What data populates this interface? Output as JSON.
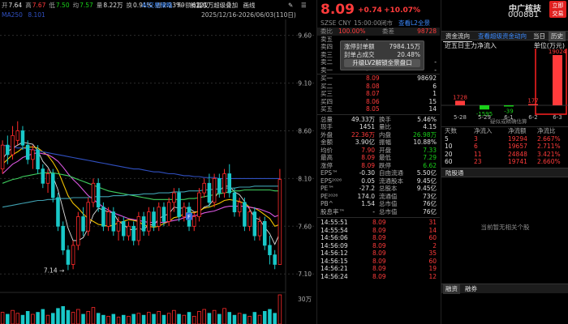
{
  "info_bar": {
    "items": [
      {
        "label": "开",
        "value": "7.64",
        "color": "#e0e0e0"
      },
      {
        "label": "高",
        "value": "7.67",
        "color": "#ff3b3b"
      },
      {
        "label": "低",
        "value": "7.50",
        "color": "#19d119"
      },
      {
        "label": "均",
        "value": "7.57",
        "color": "#19d119"
      },
      {
        "label": "量",
        "value": "8.22万",
        "color": "#e0e0e0"
      },
      {
        "label": "换",
        "value": "0.91%",
        "color": "#e0e0e0"
      },
      {
        "label": "振",
        "value": "2.23%",
        "color": "#e0e0e0"
      },
      {
        "label": "额",
        "value": "6221万",
        "color": "#e0e0e0"
      }
    ],
    "ma_label": "MA250",
    "ma_value": "8.101",
    "date_range": "2025/12/16-2026/06/03(110日)",
    "ai_label": "AI交易策略",
    "f9_label": "F9",
    "fq_label": "前复权",
    "overlay_label": "超级叠加",
    "tools_label": "画线"
  },
  "chart_data": {
    "type": "candlestick",
    "ylim": [
      7.0,
      9.75
    ],
    "yticks": [
      "9.60",
      "9.10",
      "8.60",
      "8.10",
      "7.60",
      "7.10"
    ],
    "ytick_values": [
      9.6,
      9.1,
      8.6,
      8.1,
      7.6,
      7.1
    ],
    "annotations": [
      {
        "text": "7.14",
        "value": 7.14,
        "index": 13
      },
      {
        "text": "F",
        "value": 7.7,
        "index": 37
      }
    ],
    "candles": [
      [
        8.2,
        8.45,
        8.15,
        8.5
      ],
      [
        8.45,
        8.35,
        8.25,
        8.55
      ],
      [
        8.35,
        8.55,
        8.3,
        8.65
      ],
      [
        8.5,
        8.6,
        8.45,
        8.7
      ],
      [
        8.6,
        8.45,
        8.4,
        8.65
      ],
      [
        8.45,
        8.3,
        8.25,
        8.5
      ],
      [
        8.3,
        8.4,
        8.2,
        8.45
      ],
      [
        8.4,
        8.2,
        8.15,
        8.45
      ],
      [
        8.2,
        8.05,
        8.0,
        8.25
      ],
      [
        8.05,
        8.15,
        7.95,
        8.2
      ],
      [
        8.15,
        7.9,
        7.85,
        8.2
      ],
      [
        7.9,
        7.6,
        7.55,
        7.95
      ],
      [
        7.6,
        7.35,
        7.3,
        7.65
      ],
      [
        7.35,
        7.2,
        7.14,
        7.4
      ],
      [
        7.2,
        7.4,
        7.15,
        7.45
      ],
      [
        7.4,
        7.7,
        7.35,
        7.75
      ],
      [
        7.7,
        7.55,
        7.5,
        7.8
      ],
      [
        7.55,
        7.85,
        7.5,
        7.9
      ],
      [
        7.85,
        8.05,
        7.8,
        8.1
      ],
      [
        8.05,
        7.8,
        7.75,
        8.1
      ],
      [
        7.8,
        7.6,
        7.55,
        7.85
      ],
      [
        7.6,
        7.75,
        7.55,
        7.8
      ],
      [
        7.75,
        7.55,
        7.5,
        7.8
      ],
      [
        7.55,
        7.65,
        7.45,
        7.7
      ],
      [
        7.65,
        7.5,
        7.45,
        7.7
      ],
      [
        7.5,
        7.6,
        7.45,
        7.65
      ],
      [
        7.6,
        7.45,
        7.4,
        7.65
      ],
      [
        7.45,
        7.7,
        7.4,
        7.75
      ],
      [
        7.7,
        7.55,
        7.5,
        7.75
      ],
      [
        7.55,
        7.75,
        7.5,
        7.8
      ],
      [
        7.75,
        7.6,
        7.55,
        7.8
      ],
      [
        7.6,
        7.8,
        7.55,
        7.85
      ],
      [
        7.8,
        7.65,
        7.6,
        7.85
      ],
      [
        7.65,
        7.85,
        7.6,
        7.9
      ],
      [
        7.85,
        7.95,
        7.75,
        8.0
      ],
      [
        7.95,
        7.7,
        7.65,
        8.0
      ],
      [
        7.7,
        7.8,
        7.65,
        7.85
      ],
      [
        7.8,
        7.6,
        7.55,
        7.85
      ],
      [
        7.6,
        7.7,
        7.55,
        7.75
      ],
      [
        7.7,
        7.95,
        7.65,
        8.0
      ],
      [
        7.95,
        8.05,
        7.9,
        8.1
      ],
      [
        8.05,
        7.85,
        7.8,
        8.15
      ],
      [
        7.85,
        8.1,
        7.8,
        8.15
      ],
      [
        8.1,
        7.95,
        7.9,
        8.15
      ],
      [
        7.95,
        8.15,
        7.9,
        8.2
      ],
      [
        8.15,
        7.95,
        7.9,
        8.25
      ],
      [
        7.95,
        7.75,
        7.7,
        8.0
      ],
      [
        7.75,
        7.85,
        7.7,
        7.9
      ],
      [
        7.85,
        7.6,
        7.55,
        7.9
      ],
      [
        7.6,
        7.75,
        7.55,
        7.8
      ],
      [
        7.75,
        7.5,
        7.45,
        7.8
      ],
      [
        7.5,
        7.65,
        7.45,
        7.7
      ],
      [
        7.65,
        7.4,
        7.35,
        7.7
      ],
      [
        7.4,
        7.3,
        7.2,
        7.5
      ],
      [
        7.3,
        7.2,
        7.15,
        7.35
      ],
      [
        7.2,
        8.09,
        7.2,
        8.2
      ]
    ],
    "ma_lines": [
      {
        "name": "MA5",
        "color": "#e0e0e0",
        "values": [
          8.3,
          8.38,
          8.42,
          8.45,
          8.48,
          8.47,
          8.46,
          8.39,
          8.28,
          8.22,
          8.12,
          7.98,
          7.78,
          7.58,
          7.45,
          7.45,
          7.48,
          7.58,
          7.72,
          7.79,
          7.77,
          7.75,
          7.74,
          7.65,
          7.62,
          7.57,
          7.56,
          7.58,
          7.56,
          7.62,
          7.61,
          7.68,
          7.71,
          7.73,
          7.8,
          7.79,
          7.79,
          7.79,
          7.75,
          7.75,
          7.8,
          7.82,
          7.89,
          7.97,
          8.02,
          8.02,
          7.96,
          7.93,
          7.86,
          7.78,
          7.69,
          7.67,
          7.59,
          7.52,
          7.41,
          7.53
        ]
      },
      {
        "name": "MA10",
        "color": "#f2c200",
        "values": [
          8.25,
          8.3,
          8.35,
          8.38,
          8.42,
          8.43,
          8.43,
          8.42,
          8.38,
          8.34,
          8.27,
          8.18,
          8.05,
          7.92,
          7.84,
          7.79,
          7.73,
          7.68,
          7.65,
          7.62,
          7.61,
          7.6,
          7.61,
          7.64,
          7.65,
          7.67,
          7.66,
          7.65,
          7.61,
          7.6,
          7.59,
          7.6,
          7.63,
          7.65,
          7.69,
          7.7,
          7.73,
          7.75,
          7.74,
          7.76,
          7.79,
          7.8,
          7.82,
          7.84,
          7.87,
          7.88,
          7.87,
          7.86,
          7.84,
          7.8,
          7.79,
          7.76,
          7.72,
          7.68,
          7.6,
          7.62
        ]
      },
      {
        "name": "MA20",
        "color": "#d957e0",
        "values": [
          8.15,
          8.2,
          8.25,
          8.28,
          8.32,
          8.34,
          8.36,
          8.37,
          8.36,
          8.35,
          8.32,
          8.28,
          8.22,
          8.15,
          8.09,
          8.04,
          7.98,
          7.92,
          7.88,
          7.84,
          7.8,
          7.77,
          7.74,
          7.72,
          7.7,
          7.68,
          7.67,
          7.66,
          7.65,
          7.64,
          7.64,
          7.64,
          7.64,
          7.65,
          7.66,
          7.67,
          7.69,
          7.7,
          7.71,
          7.72,
          7.74,
          7.75,
          7.76,
          7.78,
          7.8,
          7.81,
          7.81,
          7.81,
          7.81,
          7.8,
          7.79,
          7.78,
          7.76,
          7.74,
          7.7,
          7.72
        ]
      },
      {
        "name": "MA60",
        "color": "#3fcf5f",
        "values": [
          8.05,
          8.07,
          8.09,
          8.1,
          8.12,
          8.13,
          8.14,
          8.15,
          8.16,
          8.16,
          8.16,
          8.15,
          8.14,
          8.13,
          8.11,
          8.09,
          8.07,
          8.05,
          8.03,
          8.01,
          7.99,
          7.97,
          7.96,
          7.95,
          7.94,
          7.93,
          7.92,
          7.91,
          7.9,
          7.89,
          7.88,
          7.88,
          7.88,
          7.88,
          7.88,
          7.88,
          7.88,
          7.89,
          7.89,
          7.9,
          7.91,
          7.92,
          7.93,
          7.94,
          7.95,
          7.96,
          7.97,
          7.97,
          7.98,
          7.98,
          7.98,
          7.98,
          7.98,
          7.98,
          7.97,
          7.97
        ]
      },
      {
        "name": "MA120",
        "color": "#3fa0b0",
        "values": [
          7.8,
          7.81,
          7.82,
          7.83,
          7.84,
          7.85,
          7.86,
          7.87,
          7.87,
          7.88,
          7.88,
          7.89,
          7.89,
          7.89,
          7.9,
          7.9,
          7.9,
          7.9,
          7.91,
          7.91,
          7.91,
          7.91,
          7.92,
          7.92,
          7.92,
          7.93,
          7.93,
          7.93,
          7.94,
          7.94,
          7.94,
          7.95,
          7.95,
          7.95,
          7.96,
          7.96,
          7.96,
          7.97,
          7.97,
          7.97,
          7.98,
          7.98,
          7.99,
          7.99,
          8.0,
          8.0,
          8.0,
          8.01,
          8.01,
          8.01,
          8.02,
          8.02,
          8.02,
          8.02,
          8.02,
          8.02
        ]
      },
      {
        "name": "MA250",
        "color": "#3050c0",
        "values": [
          8.45,
          8.44,
          8.43,
          8.42,
          8.42,
          8.41,
          8.4,
          8.39,
          8.38,
          8.37,
          8.36,
          8.35,
          8.34,
          8.33,
          8.32,
          8.31,
          8.3,
          8.29,
          8.28,
          8.27,
          8.26,
          8.25,
          8.24,
          8.23,
          8.22,
          8.21,
          8.2,
          8.2,
          8.19,
          8.18,
          8.17,
          8.17,
          8.16,
          8.15,
          8.15,
          8.14,
          8.13,
          8.13,
          8.12,
          8.12,
          8.11,
          8.11,
          8.11,
          8.1,
          8.1,
          8.1,
          8.1,
          8.1,
          8.1,
          8.1,
          8.1,
          8.1,
          8.1,
          8.1,
          8.1,
          8.1
        ]
      }
    ],
    "volume_label": "30万",
    "volumes": [
      12,
      10,
      14,
      11,
      9,
      13,
      10,
      12,
      15,
      9,
      11,
      16,
      18,
      14,
      12,
      15,
      10,
      13,
      17,
      11,
      9,
      8,
      10,
      7,
      9,
      8,
      10,
      11,
      9,
      12,
      10,
      13,
      9,
      11,
      14,
      10,
      9,
      12,
      8,
      13,
      15,
      11,
      14,
      10,
      16,
      12,
      9,
      11,
      10,
      8,
      12,
      9,
      13,
      15,
      11,
      30
    ]
  },
  "quote": {
    "price": "8.09",
    "change": "+0.74",
    "change_pct": "+10.07%",
    "name": "中广核技",
    "code": "000881",
    "badge_top": "立即",
    "badge_bottom": "交易",
    "meta_codes": [
      "SZSE",
      "CNY",
      "15:00:00",
      "闭市"
    ],
    "l2_link": "查看L2全景",
    "webi_label": "委比",
    "webi_value": "100.00%",
    "weicha_label": "委差",
    "weicha_value": "98728",
    "sell_rows": [
      {
        "label": "卖五",
        "price": "-",
        "vol": ""
      },
      {
        "label": "卖四",
        "price": "",
        "vol": ""
      },
      {
        "label": "卖三",
        "price": "",
        "vol": ""
      },
      {
        "label": "卖二",
        "price": "-",
        "vol": "-"
      },
      {
        "label": "卖一",
        "price": "-",
        "vol": "-"
      }
    ],
    "popup": {
      "rows": [
        [
          "涨停封单额",
          "7984.15万"
        ],
        [
          "封单占成交",
          "20.48%"
        ]
      ],
      "button": "升级LV2解锁全景盘口"
    },
    "buy_rows": [
      {
        "label": "买一",
        "price": "8.09",
        "vol": "98692"
      },
      {
        "label": "买二",
        "price": "8.08",
        "vol": "6"
      },
      {
        "label": "买三",
        "price": "8.07",
        "vol": "1"
      },
      {
        "label": "买四",
        "price": "8.06",
        "vol": "15"
      },
      {
        "label": "买五",
        "price": "8.05",
        "vol": "14"
      }
    ],
    "stats": [
      [
        "总量",
        "49.33万",
        "#e0e0e0",
        "换手",
        "5.46%",
        "#e0e0e0"
      ],
      [
        "现手",
        "1451",
        "#e0e0e0",
        "量比",
        "4.15",
        "#e0e0e0"
      ],
      [
        "外盘",
        "22.36万",
        "#ff3b3b",
        "内盘",
        "26.98万",
        "#19d119"
      ],
      [
        "金额",
        "3.90亿",
        "#e0e0e0",
        "振幅",
        "10.88%",
        "#e0e0e0"
      ],
      [
        "均价",
        "7.90",
        "#ff3b3b",
        "开盘",
        "7.33",
        "#19d119"
      ],
      [
        "最高",
        "8.09",
        "#ff3b3b",
        "最低",
        "7.29",
        "#19d119"
      ],
      [
        "涨停",
        "8.09",
        "#ff3b3b",
        "跌停",
        "6.62",
        "#19d119"
      ],
      [
        "EPS™",
        "-0.30",
        "#e0e0e0",
        "自由流通",
        "5.50亿",
        "#e0e0e0"
      ],
      [
        "EPS²⁰²⁶",
        "0.05",
        "#e0e0e0",
        "流通股本",
        "9.45亿",
        "#e0e0e0"
      ],
      [
        "PE™",
        "-27.2",
        "#e0e0e0",
        "总股本",
        "9.45亿",
        "#e0e0e0"
      ],
      [
        "PE²⁰²⁶",
        "174.0",
        "#e0e0e0",
        "流通值",
        "73亿",
        "#e0e0e0"
      ],
      [
        "PB^",
        "1.54",
        "#e0e0e0",
        "总市值",
        "76亿",
        "#e0e0e0"
      ],
      [
        "股息率™",
        "-",
        "#e0e0e0",
        "总市值",
        "76亿",
        "#e0e0e0"
      ]
    ],
    "ticks": [
      [
        "14:55:51",
        "8.09",
        "31"
      ],
      [
        "14:55:54",
        "8.09",
        "14"
      ],
      [
        "14:56:06",
        "8.09",
        "60"
      ],
      [
        "14:56:09",
        "8.09",
        "2"
      ],
      [
        "14:56:12",
        "8.09",
        "35"
      ],
      [
        "14:56:15",
        "8.09",
        "60"
      ],
      [
        "14:56:21",
        "8.09",
        "19"
      ],
      [
        "14:56:24",
        "8.09",
        "12"
      ]
    ]
  },
  "capital": {
    "tabs": [
      "资金流向",
      "查看超级资金动向",
      "当日",
      "历史"
    ],
    "title": "近五日主力净流入",
    "unit": "单位(万元)",
    "bars": [
      {
        "date": "5-28",
        "value": 1728
      },
      {
        "date": "5-29",
        "value": -1595
      },
      {
        "date": "6-1",
        "value": -39
      },
      {
        "date": "6-2",
        "value": 177
      },
      {
        "date": "6-3",
        "value": 19024
      }
    ],
    "sub_caption": "疑似或精确估算",
    "table_headers": [
      "天数",
      "净流入",
      "净流额",
      "净流比"
    ],
    "table_rows": [
      [
        "5",
        "3",
        "19294",
        "2.667%"
      ],
      [
        "10",
        "6",
        "19657",
        "2.711%"
      ],
      [
        "20",
        "11",
        "24848",
        "3.421%"
      ],
      [
        "60",
        "23",
        "19741",
        "2.660%"
      ]
    ],
    "news_title": "陆股通",
    "no_news": "当前暂无相关个股",
    "bottom_tabs": [
      "融资",
      "融券"
    ]
  }
}
